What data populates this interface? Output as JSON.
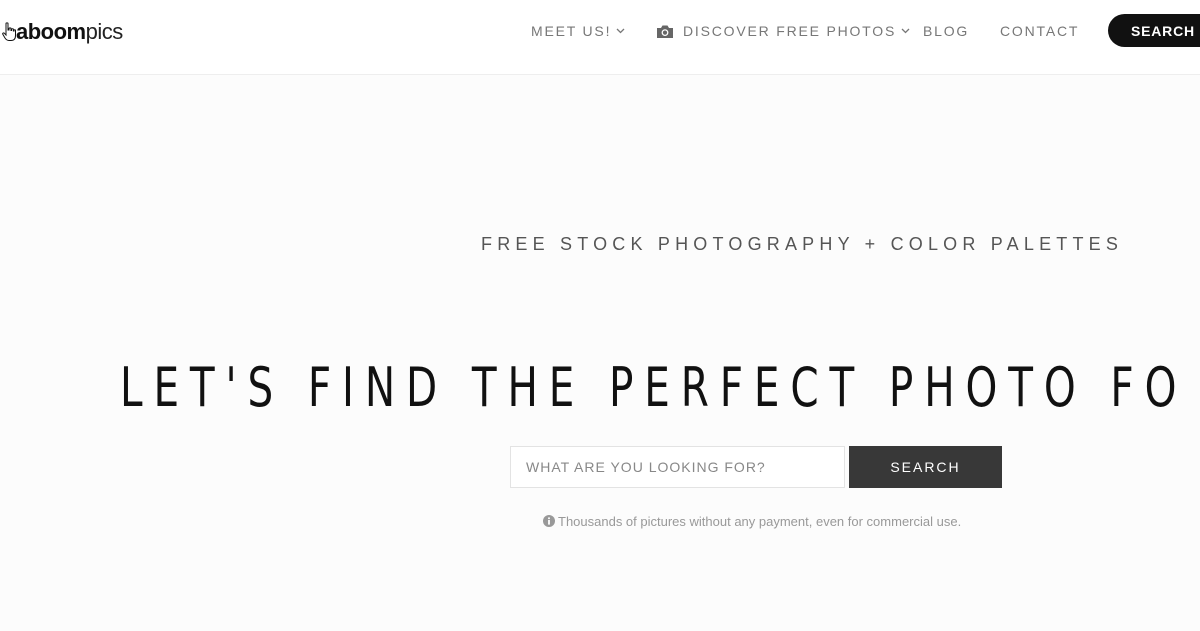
{
  "header": {
    "logo": {
      "first": "aboom",
      "second": "pics"
    },
    "nav": [
      {
        "label": "MEET US!",
        "has_dropdown": true
      },
      {
        "label": "DISCOVER FREE PHOTOS",
        "has_dropdown": true,
        "icon": "camera-icon"
      },
      {
        "label": "BLOG",
        "has_dropdown": false
      },
      {
        "label": "CONTACT",
        "has_dropdown": false
      }
    ],
    "cta_label": "SEARCH FR"
  },
  "hero": {
    "tagline": "FREE STOCK PHOTOGRAPHY + COLOR PALETTES",
    "headline": "LET'S FIND THE PERFECT PHOTO FO",
    "search": {
      "placeholder": "WHAT ARE YOU LOOKING FOR?",
      "button_label": "SEARCH"
    },
    "note": "Thousands of pictures without any payment, even for commercial use."
  },
  "colors": {
    "cta_background": "#111111",
    "search_button": "#383838",
    "nav_text": "#777777"
  }
}
